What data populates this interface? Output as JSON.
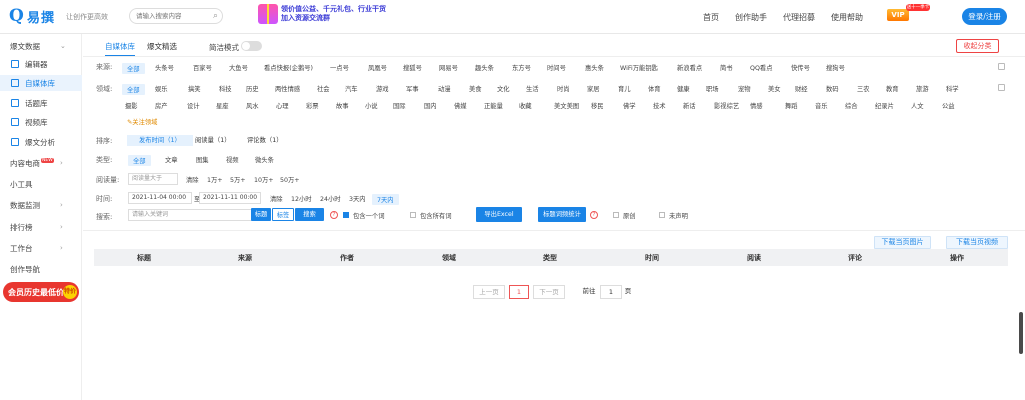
{
  "header": {
    "logo": "易撰",
    "slogan": "让创作更高效",
    "search_placeholder": "请输入搜索内容",
    "promo_line1": "领价值公益、千元礼包、行业干货",
    "promo_line2": "加入资源交流群",
    "nav": [
      "首页",
      "创作助手",
      "代理招募",
      "使用帮助"
    ],
    "vip_label": "VIP",
    "vip_badge": "送十一季卡",
    "login": "登录/注册"
  },
  "sidebar": {
    "items": [
      {
        "label": "爆文数据",
        "icon": ""
      },
      {
        "label": "编辑器",
        "icon": "edit-icon"
      },
      {
        "label": "自媒体库",
        "icon": "book-icon"
      },
      {
        "label": "话题库",
        "icon": "topic-icon"
      },
      {
        "label": "视频库",
        "icon": "video-icon"
      },
      {
        "label": "爆文分析",
        "icon": "chart-icon"
      },
      {
        "label": "内容电商",
        "icon": ""
      },
      {
        "label": "小工具",
        "icon": ""
      },
      {
        "label": "数据监测",
        "icon": ""
      },
      {
        "label": "排行榜",
        "icon": ""
      },
      {
        "label": "工作台",
        "icon": ""
      },
      {
        "label": "创作导航",
        "icon": ""
      }
    ],
    "new_tag": "NEW",
    "banner": "会员历史最低价",
    "banner_coin": "特价"
  },
  "main": {
    "tabs": [
      "自媒体库",
      "爆文精选"
    ],
    "simple_mode": "简洁模式",
    "collect": "收起分类",
    "source_label": "来源:",
    "sources": [
      "全部",
      "头条号",
      "百家号",
      "大鱼号",
      "看点快报(企鹅号)",
      "一点号",
      "凤凰号",
      "搜狐号",
      "网易号",
      "趣头条",
      "东方号",
      "时间号",
      "惠头条",
      "WiFi万能钥匙",
      "新浪看点",
      "简书",
      "QQ看点",
      "快传号",
      "搜狗号"
    ],
    "field_label": "领域:",
    "fields1": [
      "全部",
      "娱乐",
      "搞笑",
      "科技",
      "历史",
      "两性情感",
      "社会",
      "汽车",
      "游戏",
      "军事",
      "动漫",
      "美食",
      "文化",
      "生活",
      "时尚",
      "家居",
      "育儿",
      "体育",
      "健康",
      "职场",
      "宠物",
      "美女",
      "财经",
      "数码",
      "三农",
      "教育",
      "旅游",
      "科学"
    ],
    "fields2": [
      "摄影",
      "房产",
      "设计",
      "星座",
      "风水",
      "心理",
      "彩票",
      "故事",
      "小说",
      "国际",
      "国内",
      "佛媒",
      "正能量",
      "收藏",
      "美文美图",
      "移民",
      "佛学",
      "技术",
      "新话",
      "影视综艺",
      "情感",
      "舞蹈",
      "音乐",
      "综合",
      "纪录片",
      "人文",
      "公益"
    ],
    "focus_field": "关注领域",
    "sort_label": "排序:",
    "sort": [
      "发布时间（1）",
      "阅读量（1）",
      "评论数（1）"
    ],
    "type_label": "类型:",
    "types": [
      "全部",
      "文章",
      "图集",
      "视频",
      "微头条"
    ],
    "read_label": "阅读量:",
    "read_placeholder": "阅读量大于",
    "read_opts": [
      "清除",
      "1万+",
      "5万+",
      "10万+",
      "50万+"
    ],
    "time_label": "时间:",
    "time_start": "2021-11-04 00:00",
    "time_sep": "至",
    "time_end": "2021-11-11 00:00",
    "time_opts": [
      "清除",
      "12小时",
      "24小时",
      "3天内",
      "7天内"
    ],
    "search_label": "搜索:",
    "search_placeholder": "请输入关键词",
    "title_btn": "标题",
    "tag_btn": "标签",
    "search_btn": "搜索",
    "contain_one": "包含一个词",
    "contain_all": "包含所有词",
    "export": "导出Excel",
    "title_stats": "标题词频统计",
    "original": "原创",
    "unclaimed": "未声明",
    "download_img": "下载当页图片",
    "download_video": "下载当页视频",
    "columns": [
      "标题",
      "来源",
      "作者",
      "领域",
      "类型",
      "时间",
      "阅读",
      "评论",
      "操作"
    ],
    "pager": {
      "prev": "上一页",
      "current": "1",
      "next": "下一页",
      "goto": "前往",
      "goto_val": "1",
      "page": "页"
    }
  }
}
